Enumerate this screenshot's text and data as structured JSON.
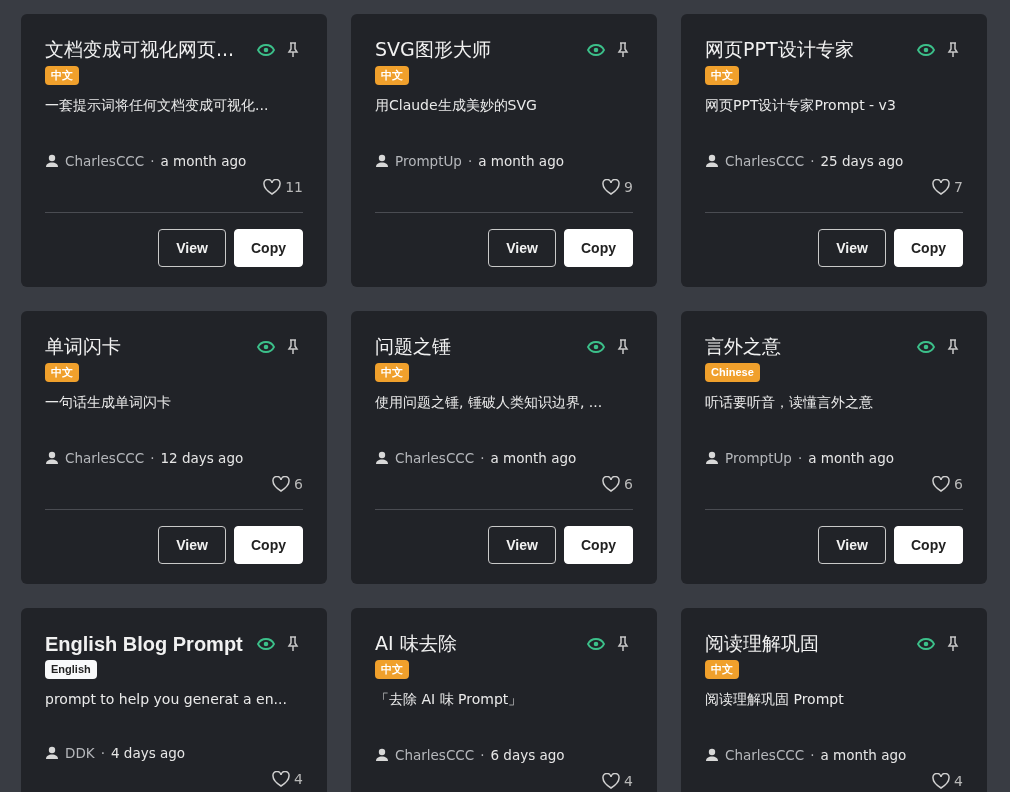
{
  "cards": [
    {
      "title": "文档变成可视化网页...",
      "tag": {
        "label": "中文",
        "color": "#f0a02c"
      },
      "description": "一套提示词将任何文档变成可视化...",
      "author": "CharlesCCC",
      "separator": "·",
      "time": "a month ago",
      "likes": "11",
      "buttons": [
        "View",
        "Copy"
      ]
    },
    {
      "title": "SVG图形大师",
      "tag": {
        "label": "中文",
        "color": "#f0a02c"
      },
      "description": "用Claude生成美妙的SVG",
      "author": "PromptUp",
      "separator": "·",
      "time": "a month ago",
      "likes": "9",
      "buttons": [
        "View",
        "Copy"
      ]
    },
    {
      "title": "网页PPT设计专家",
      "tag": {
        "label": "中文",
        "color": "#f0a02c"
      },
      "description": "网页PPT设计专家Prompt - v3",
      "author": "CharlesCCC",
      "separator": "·",
      "time": "25 days ago",
      "likes": "7",
      "buttons": [
        "View",
        "Copy"
      ]
    },
    {
      "title": "单词闪卡",
      "tag": {
        "label": "中文",
        "color": "#f0a02c"
      },
      "description": "一句话生成单词闪卡",
      "author": "CharlesCCC",
      "separator": "·",
      "time": "12 days ago",
      "likes": "6",
      "buttons": [
        "View",
        "Copy"
      ]
    },
    {
      "title": "问题之锤",
      "tag": {
        "label": "中文",
        "color": "#f0a02c"
      },
      "description": "使用问题之锤, 锤破人类知识边界, ...",
      "author": "CharlesCCC",
      "separator": "·",
      "time": "a month ago",
      "likes": "6",
      "buttons": [
        "View",
        "Copy"
      ]
    },
    {
      "title": "言外之意",
      "tag": {
        "label": "Chinese",
        "color": "#f0a02c"
      },
      "description": "听话要听音，读懂言外之意",
      "author": "PromptUp",
      "separator": "·",
      "time": "a month ago",
      "likes": "6",
      "buttons": [
        "View",
        "Copy"
      ]
    },
    {
      "title": "English Blog Prompt",
      "tag": {
        "label": "English",
        "color": "#f8f9fa"
      },
      "description": "prompt to help you generat a en...",
      "author": "DDK",
      "separator": "·",
      "time": "4 days ago",
      "likes": "4"
    },
    {
      "title": "AI 味去除",
      "tag": {
        "label": "中文",
        "color": "#f0a02c"
      },
      "description": "「去除 AI 味 Prompt」",
      "author": "CharlesCCC",
      "separator": "·",
      "time": "6 days ago",
      "likes": "4"
    },
    {
      "title": "阅读理解巩固",
      "tag": {
        "label": "中文",
        "color": "#f0a02c"
      },
      "description": "阅读理解巩固 Prompt",
      "author": "CharlesCCC",
      "separator": "·",
      "time": "a month ago",
      "likes": "4"
    }
  ]
}
